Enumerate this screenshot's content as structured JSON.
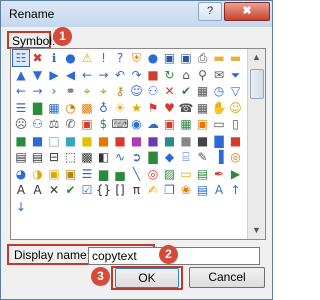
{
  "window": {
    "title": "Rename",
    "help_label": "?",
    "close_label": "✖"
  },
  "symbol_label": "Symbol:",
  "annotations": {
    "step1": "1",
    "step2": "2",
    "step3": "3"
  },
  "symbols": [
    {
      "name": "org-chart-icon",
      "glyph": "☷",
      "color": "#3a6fb0"
    },
    {
      "name": "error-icon",
      "glyph": "✖",
      "color": "#d33b2c"
    },
    {
      "name": "info-icon",
      "glyph": "ℹ",
      "color": "#2c6bd6"
    },
    {
      "name": "dots-icon",
      "glyph": "●",
      "color": "#2c6bd6"
    },
    {
      "name": "warning-icon",
      "glyph": "⚠",
      "color": "#e0a800"
    },
    {
      "name": "exclamation-icon",
      "glyph": "!",
      "color": "#d33b2c"
    },
    {
      "name": "question-icon",
      "glyph": "?",
      "color": "#2c6bd6"
    },
    {
      "name": "shield-icon",
      "glyph": "⛨",
      "color": "#e07a00"
    },
    {
      "name": "blue-circle-icon",
      "glyph": "●",
      "color": "#2c6bd6"
    },
    {
      "name": "save-icon",
      "glyph": "▣",
      "color": "#2a56a8"
    },
    {
      "name": "save-as-icon",
      "glyph": "▣",
      "color": "#2a56a8"
    },
    {
      "name": "print-icon",
      "glyph": "⎙",
      "color": "#555555"
    },
    {
      "name": "folder-icon",
      "glyph": "▬",
      "color": "#e3b341"
    },
    {
      "name": "open-folder-icon",
      "glyph": "▬",
      "color": "#e3b341"
    },
    {
      "name": "up-icon",
      "glyph": "▲",
      "color": "#2c6bd6"
    },
    {
      "name": "down-icon",
      "glyph": "▼",
      "color": "#2c6bd6"
    },
    {
      "name": "right-icon",
      "glyph": "▶",
      "color": "#2c6bd6"
    },
    {
      "name": "left-icon",
      "glyph": "◀",
      "color": "#2c6bd6"
    },
    {
      "name": "back-arrow-icon",
      "glyph": "←",
      "color": "#2c6bd6"
    },
    {
      "name": "forward-arrow-icon",
      "glyph": "→",
      "color": "#2c6bd6"
    },
    {
      "name": "undo-icon",
      "glyph": "↶",
      "color": "#2c6bd6"
    },
    {
      "name": "redo-icon",
      "glyph": "↷",
      "color": "#2c6bd6"
    },
    {
      "name": "stop-icon",
      "glyph": "■",
      "color": "#d33b2c"
    },
    {
      "name": "refresh-icon",
      "glyph": "↻",
      "color": "#2c8a3c"
    },
    {
      "name": "home-icon",
      "glyph": "⌂",
      "color": "#555555"
    },
    {
      "name": "search-icon",
      "glyph": "⚲",
      "color": "#555555"
    },
    {
      "name": "mail-icon",
      "glyph": "✉",
      "color": "#555555"
    },
    {
      "name": "filter-icon",
      "glyph": "⏷",
      "color": "#2c6bd6"
    },
    {
      "name": "arrow-left-icon",
      "glyph": "←",
      "color": "#2c6bd6"
    },
    {
      "name": "arrow-right-icon",
      "glyph": "→",
      "color": "#2c6bd6"
    },
    {
      "name": "chevron-right-icon",
      "glyph": "›",
      "color": "#2c6bd6"
    },
    {
      "name": "link-icon",
      "glyph": "⚭",
      "color": "#555555"
    },
    {
      "name": "lock-icon",
      "glyph": "⌖",
      "color": "#b8860b"
    },
    {
      "name": "unlock-icon",
      "glyph": "⌖",
      "color": "#b8860b"
    },
    {
      "name": "key-icon",
      "glyph": "⚷",
      "color": "#b8860b"
    },
    {
      "name": "user-icon",
      "glyph": "☺",
      "color": "#2c6bd6"
    },
    {
      "name": "group-icon",
      "glyph": "⚇",
      "color": "#2c6bd6"
    },
    {
      "name": "close-x-icon",
      "glyph": "✕",
      "color": "#d33b2c"
    },
    {
      "name": "check-mark-icon",
      "glyph": "✔",
      "color": "#2c8a3c"
    },
    {
      "name": "calendar-icon",
      "glyph": "▦",
      "color": "#555555"
    },
    {
      "name": "clock-icon",
      "glyph": "◷",
      "color": "#2c6bd6"
    },
    {
      "name": "funnel-icon",
      "glyph": "▽",
      "color": "#2c6bd6"
    },
    {
      "name": "book-icon",
      "glyph": "☰",
      "color": "#2c6bd6"
    },
    {
      "name": "chart-icon",
      "glyph": "▇",
      "color": "#2c8a3c"
    },
    {
      "name": "table-icon",
      "glyph": "▦",
      "color": "#2c6bd6"
    },
    {
      "name": "pie-chart-icon",
      "glyph": "◔",
      "color": "#e07a00"
    },
    {
      "name": "puzzle-icon",
      "glyph": "▩",
      "color": "#e07a00"
    },
    {
      "name": "globe-icon",
      "glyph": "♁",
      "color": "#2c6bd6"
    },
    {
      "name": "bulb-icon",
      "glyph": "☀",
      "color": "#e0a800"
    },
    {
      "name": "star-icon",
      "glyph": "★",
      "color": "#e0a800"
    },
    {
      "name": "flag-icon",
      "glyph": "⚑",
      "color": "#d33b2c"
    },
    {
      "name": "heart-icon",
      "glyph": "♥",
      "color": "#d33b2c"
    },
    {
      "name": "phone-icon",
      "glyph": "☎",
      "color": "#555555"
    },
    {
      "name": "grid-icon",
      "glyph": "▦",
      "color": "#555555"
    },
    {
      "name": "hand-icon",
      "glyph": "✋",
      "color": "#e0a800"
    },
    {
      "name": "smiley-icon",
      "glyph": "☺",
      "color": "#e0a800"
    },
    {
      "name": "frown-icon",
      "glyph": "☹",
      "color": "#555555"
    },
    {
      "name": "people-icon",
      "glyph": "⚇",
      "color": "#2c6bd6"
    },
    {
      "name": "scale-icon",
      "glyph": "⚖",
      "color": "#555555"
    },
    {
      "name": "phone-handset-icon",
      "glyph": "✆",
      "color": "#555555"
    },
    {
      "name": "gift-icon",
      "glyph": "▣",
      "color": "#d33b2c"
    },
    {
      "name": "dollar-icon",
      "glyph": "$",
      "color": "#2c8a3c"
    },
    {
      "name": "computer-icon",
      "glyph": "⌨",
      "color": "#555555"
    },
    {
      "name": "eye-icon",
      "glyph": "◉",
      "color": "#2c6bd6"
    },
    {
      "name": "cloud-icon",
      "glyph": "☁",
      "color": "#2c6bd6"
    },
    {
      "name": "color-palette-icon",
      "glyph": "▣",
      "color": "#d33b2c"
    },
    {
      "name": "tile-icon",
      "glyph": "▦",
      "color": "#2c8a3c"
    },
    {
      "name": "color-box-icon",
      "glyph": "▣",
      "color": "#e07a00"
    },
    {
      "name": "note-icon",
      "glyph": "▭",
      "color": "#555555"
    },
    {
      "name": "document-icon",
      "glyph": "▯",
      "color": "#555555"
    },
    {
      "name": "green-square-icon",
      "glyph": "■",
      "color": "#2c8a3c"
    },
    {
      "name": "blue-square-icon",
      "glyph": "■",
      "color": "#2c6bd6"
    },
    {
      "name": "light-square-icon",
      "glyph": "□",
      "color": "#7a9bc8"
    },
    {
      "name": "cyan-square-icon",
      "glyph": "■",
      "color": "#3aa6c0"
    },
    {
      "name": "yellow-square-icon",
      "glyph": "■",
      "color": "#e0c000"
    },
    {
      "name": "orange-square-icon",
      "glyph": "■",
      "color": "#e07a00"
    },
    {
      "name": "red-square-icon",
      "glyph": "■",
      "color": "#d33b2c"
    },
    {
      "name": "magenta-square-icon",
      "glyph": "■",
      "color": "#b03ab0"
    },
    {
      "name": "purple-square-icon",
      "glyph": "■",
      "color": "#6a3ab0"
    },
    {
      "name": "teal-square-icon",
      "glyph": "■",
      "color": "#2a8a8a"
    },
    {
      "name": "gray-square-icon",
      "glyph": "■",
      "color": "#888888"
    },
    {
      "name": "dark-square-icon",
      "glyph": "■",
      "color": "#444444"
    },
    {
      "name": "chart-bars-icon",
      "glyph": "▇",
      "color": "#2c6bd6"
    },
    {
      "name": "red-icon",
      "glyph": "■",
      "color": "#d33b2c"
    },
    {
      "name": "top-box-icon",
      "glyph": "▤",
      "color": "#333333"
    },
    {
      "name": "bottom-box-icon",
      "glyph": "▤",
      "color": "#333333"
    },
    {
      "name": "minus-box-icon",
      "glyph": "⊟",
      "color": "#333333"
    },
    {
      "name": "dotted-box-icon",
      "glyph": "⬚",
      "color": "#333333"
    },
    {
      "name": "checker-icon",
      "glyph": "▩",
      "color": "#333333"
    },
    {
      "name": "split-box-icon",
      "glyph": "◧",
      "color": "#333333"
    },
    {
      "name": "wave-icon",
      "glyph": "∿",
      "color": "#2c6bd6"
    },
    {
      "name": "arrow-circle-icon",
      "glyph": "➲",
      "color": "#2c6bd6"
    },
    {
      "name": "bars-icon",
      "glyph": "▇",
      "color": "#2c8a3c"
    },
    {
      "name": "crystal-icon",
      "glyph": "◆",
      "color": "#2c6bd6"
    },
    {
      "name": "cylinder-icon",
      "glyph": "⌸",
      "color": "#2c6bd6"
    },
    {
      "name": "pencil-icon",
      "glyph": "✎",
      "color": "#555555"
    },
    {
      "name": "columns-icon",
      "glyph": "▐",
      "color": "#2c6bd6"
    },
    {
      "name": "ring-icon",
      "glyph": "◎",
      "color": "#e07a00"
    },
    {
      "name": "donut-icon",
      "glyph": "◕",
      "color": "#2c6bd6"
    },
    {
      "name": "pie-icon",
      "glyph": "◑",
      "color": "#e0a800"
    },
    {
      "name": "box-icon",
      "glyph": "▣",
      "color": "#e0a800"
    },
    {
      "name": "package-icon",
      "glyph": "▣",
      "color": "#b8860b"
    },
    {
      "name": "stack-icon",
      "glyph": "☰",
      "color": "#2c6bd6"
    },
    {
      "name": "bar-chart-icon",
      "glyph": "▆",
      "color": "#2c8a3c"
    },
    {
      "name": "green-chart-icon",
      "glyph": "▅",
      "color": "#2c8a3c"
    },
    {
      "name": "line-chart-icon",
      "glyph": "╲",
      "color": "#2c6bd6"
    },
    {
      "name": "target-icon",
      "glyph": "◎",
      "color": "#d33b2c"
    },
    {
      "name": "image-icon",
      "glyph": "▨",
      "color": "#2c8a3c"
    },
    {
      "name": "ruler-icon",
      "glyph": "▭",
      "color": "#e0a800"
    },
    {
      "name": "sheet-icon",
      "glyph": "▤",
      "color": "#2c8a3c"
    },
    {
      "name": "paint-icon",
      "glyph": "✒",
      "color": "#d33b2c"
    },
    {
      "name": "play-icon",
      "glyph": "▶",
      "color": "#2c8a3c"
    },
    {
      "name": "text-a-icon",
      "glyph": "A",
      "color": "#333333"
    },
    {
      "name": "text-a-outline-icon",
      "glyph": "A",
      "color": "#333333"
    },
    {
      "name": "x-icon",
      "glyph": "✕",
      "color": "#333333"
    },
    {
      "name": "checkmark-icon",
      "glyph": "✔",
      "color": "#2c8a3c"
    },
    {
      "name": "list-check-icon",
      "glyph": "☑",
      "color": "#2c6bd6"
    },
    {
      "name": "braces-icon",
      "glyph": "{}",
      "color": "#333333"
    },
    {
      "name": "brackets-icon",
      "glyph": "[]",
      "color": "#333333"
    },
    {
      "name": "pi-icon",
      "glyph": "π",
      "color": "#333333"
    },
    {
      "name": "brush-icon",
      "glyph": "✍",
      "color": "#e0a800"
    },
    {
      "name": "bucket-icon",
      "glyph": "❒",
      "color": "#2c6bd6"
    },
    {
      "name": "palette-icon",
      "glyph": "❀",
      "color": "#e07a00"
    },
    {
      "name": "sheet-edit-icon",
      "glyph": "▤",
      "color": "#2c6bd6"
    },
    {
      "name": "font-icon",
      "glyph": "A",
      "color": "#2c6bd6"
    },
    {
      "name": "arrow-up-icon",
      "glyph": "↑",
      "color": "#2c6bd6"
    },
    {
      "name": "arrow-down-icon",
      "glyph": "↓",
      "color": "#2c6bd6"
    }
  ],
  "name_label": "Display name:",
  "name_value": "copytext",
  "ok_label": "OK",
  "cancel_label": "Cancel",
  "scrollbar": {
    "up": "▲",
    "down": "▼"
  }
}
